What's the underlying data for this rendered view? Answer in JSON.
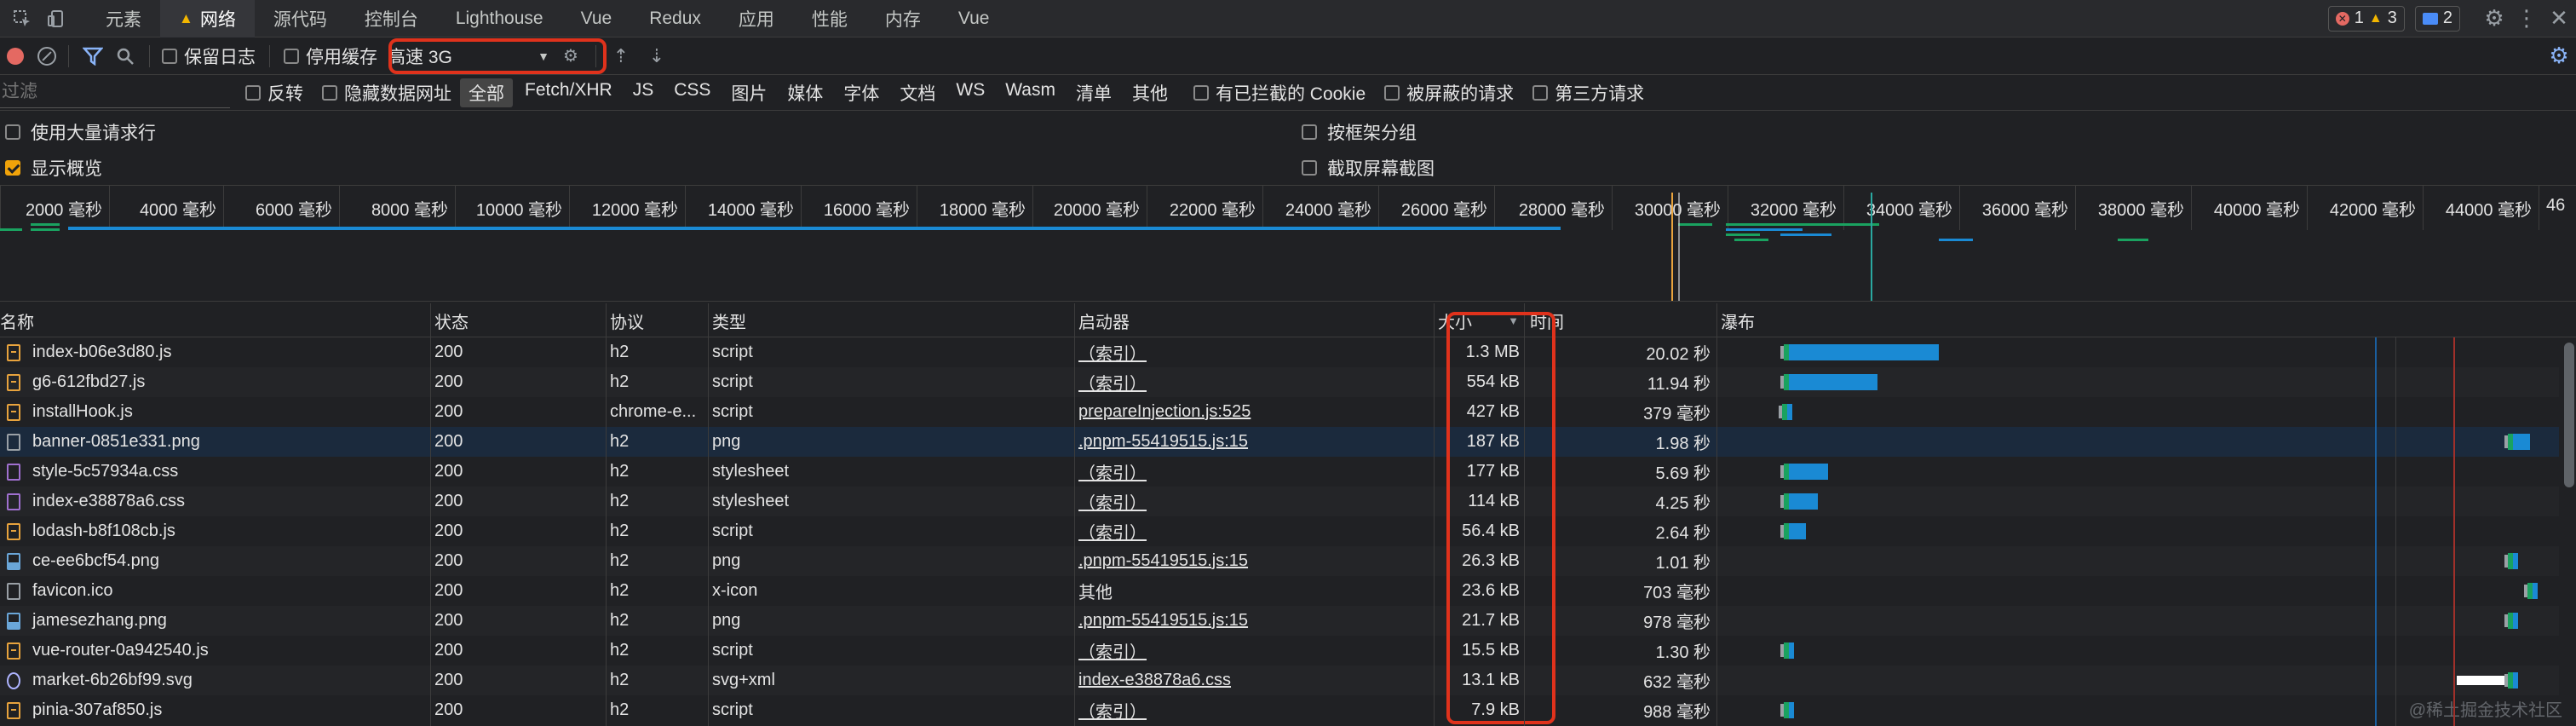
{
  "tabs": [
    "元素",
    "网络",
    "源代码",
    "控制台",
    "Lighthouse",
    "Vue",
    "Redux",
    "应用",
    "性能",
    "内存",
    "Vue"
  ],
  "badges": {
    "errors": "1",
    "warnings": "3",
    "messages": "2"
  },
  "toolbar": {
    "preserve_log": "保留日志",
    "disable_cache": "停用缓存",
    "throttle": "高速 3G"
  },
  "filter": {
    "placeholder": "过滤",
    "invert": "反转",
    "hide_data_urls": "隐藏数据网址",
    "types": [
      "全部",
      "Fetch/XHR",
      "JS",
      "CSS",
      "图片",
      "媒体",
      "字体",
      "文档",
      "WS",
      "Wasm",
      "清单",
      "其他"
    ],
    "blocked_cookies": "有已拦截的 Cookie",
    "blocked_requests": "被屏蔽的请求",
    "third_party": "第三方请求"
  },
  "options": {
    "big_rows": "使用大量请求行",
    "group_by_frame": "按框架分组",
    "show_overview": "显示概览",
    "capture_screenshots": "截取屏幕截图"
  },
  "timeline_ticks": [
    "2000 毫秒",
    "4000 毫秒",
    "6000 毫秒",
    "8000 毫秒",
    "10000 毫秒",
    "12000 毫秒",
    "14000 毫秒",
    "16000 毫秒",
    "18000 毫秒",
    "20000 毫秒",
    "22000 毫秒",
    "24000 毫秒",
    "26000 毫秒",
    "28000 毫秒",
    "30000 毫秒",
    "32000 毫秒",
    "34000 毫秒",
    "36000 毫秒",
    "38000 毫秒",
    "40000 毫秒",
    "42000 毫秒",
    "44000 毫秒",
    "46"
  ],
  "columns": {
    "name": "名称",
    "status": "状态",
    "protocol": "协议",
    "type": "类型",
    "initiator": "启动器",
    "size": "大小",
    "time": "时间",
    "waterfall": "瀑布"
  },
  "rows": [
    {
      "icon": "js",
      "name": "index-b06e3d80.js",
      "status": "200",
      "protocol": "h2",
      "type": "script",
      "initiator": "（索引）",
      "size": "1.3 MB",
      "time": "20.02 秒",
      "wf_start": 0.075,
      "wf_wait": 0.005,
      "wf_dl": 0.178
    },
    {
      "icon": "js",
      "name": "g6-612fbd27.js",
      "status": "200",
      "protocol": "h2",
      "type": "script",
      "initiator": "（索引）",
      "size": "554 kB",
      "time": "11.94 秒",
      "wf_start": 0.075,
      "wf_wait": 0.005,
      "wf_dl": 0.105
    },
    {
      "icon": "js",
      "name": "installHook.js",
      "status": "200",
      "protocol": "chrome-e...",
      "type": "script",
      "initiator": "prepareInjection.js:525",
      "size": "427 kB",
      "time": "379 毫秒",
      "wf_start": 0.073,
      "wf_wait": 0.0,
      "wf_dl": 0.004
    },
    {
      "icon": "doc",
      "name": "banner-0851e331.png",
      "status": "200",
      "protocol": "h2",
      "type": "png",
      "initiator": ".pnpm-55419515.js:15",
      "size": "187 kB",
      "time": "1.98 秒",
      "wf_start": 0.935,
      "wf_wait": 0.005,
      "wf_dl": 0.02
    },
    {
      "icon": "css",
      "name": "style-5c57934a.css",
      "status": "200",
      "protocol": "h2",
      "type": "stylesheet",
      "initiator": "（索引）",
      "size": "177 kB",
      "time": "5.69 秒",
      "wf_start": 0.075,
      "wf_wait": 0.005,
      "wf_dl": 0.046
    },
    {
      "icon": "css",
      "name": "index-e38878a6.css",
      "status": "200",
      "protocol": "h2",
      "type": "stylesheet",
      "initiator": "（索引）",
      "size": "114 kB",
      "time": "4.25 秒",
      "wf_start": 0.075,
      "wf_wait": 0.005,
      "wf_dl": 0.034
    },
    {
      "icon": "js",
      "name": "lodash-b8f108cb.js",
      "status": "200",
      "protocol": "h2",
      "type": "script",
      "initiator": "（索引）",
      "size": "56.4 kB",
      "time": "2.64 秒",
      "wf_start": 0.075,
      "wf_wait": 0.005,
      "wf_dl": 0.02
    },
    {
      "icon": "img",
      "name": "ce-ee6bcf54.png",
      "status": "200",
      "protocol": "h2",
      "type": "png",
      "initiator": ".pnpm-55419515.js:15",
      "size": "26.3 kB",
      "time": "1.01 秒",
      "wf_start": 0.935,
      "wf_wait": 0.005,
      "wf_dl": 0.005
    },
    {
      "icon": "doc",
      "name": "favicon.ico",
      "status": "200",
      "protocol": "h2",
      "type": "x-icon",
      "initiator": "其他",
      "size": "23.6 kB",
      "time": "703 毫秒",
      "wf_start": 0.958,
      "wf_wait": 0.004,
      "wf_dl": 0.004
    },
    {
      "icon": "img",
      "name": "jamesezhang.png",
      "status": "200",
      "protocol": "h2",
      "type": "png",
      "initiator": ".pnpm-55419515.js:15",
      "size": "21.7 kB",
      "time": "978 毫秒",
      "wf_start": 0.935,
      "wf_wait": 0.005,
      "wf_dl": 0.005
    },
    {
      "icon": "js",
      "name": "vue-router-0a942540.js",
      "status": "200",
      "protocol": "h2",
      "type": "script",
      "initiator": "（索引）",
      "size": "15.5 kB",
      "time": "1.30 秒",
      "wf_start": 0.075,
      "wf_wait": 0.005,
      "wf_dl": 0.006
    },
    {
      "icon": "svg",
      "name": "market-6b26bf99.svg",
      "status": "200",
      "protocol": "h2",
      "type": "svg+xml",
      "initiator": "index-e38878a6.css",
      "size": "13.1 kB",
      "time": "632 毫秒",
      "wf_start": 0.935,
      "wf_wait": 0.005,
      "wf_dl": 0.004
    },
    {
      "icon": "js",
      "name": "pinia-307af850.js",
      "status": "200",
      "protocol": "h2",
      "type": "script",
      "initiator": "（索引）",
      "size": "7.9 kB",
      "time": "988 毫秒",
      "wf_start": 0.075,
      "wf_wait": 0.005,
      "wf_dl": 0.005
    }
  ],
  "watermark": "@稀土掘金技术社区",
  "colors": {
    "highlight": "#e0321c",
    "waiting": "#1aa260",
    "download": "#1a8ad4",
    "selected_row": "#1b2a3d"
  }
}
